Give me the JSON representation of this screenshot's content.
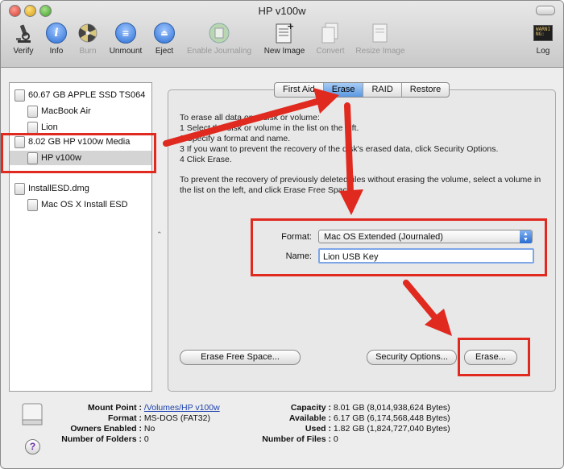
{
  "window": {
    "title": "HP v100w"
  },
  "toolbar": {
    "items": [
      {
        "label": "Verify",
        "icon": "microscope-icon"
      },
      {
        "label": "Info",
        "icon": "info-icon"
      },
      {
        "label": "Burn",
        "icon": "burn-icon"
      },
      {
        "label": "Unmount",
        "icon": "unmount-icon"
      },
      {
        "label": "Eject",
        "icon": "eject-icon"
      },
      {
        "label": "Enable Journaling",
        "icon": "journaling-icon"
      },
      {
        "label": "New Image",
        "icon": "new-image-icon"
      },
      {
        "label": "Convert",
        "icon": "convert-icon"
      },
      {
        "label": "Resize Image",
        "icon": "resize-image-icon"
      },
      {
        "label": "Log",
        "icon": "log-icon"
      }
    ],
    "log_badge": "WARNI\nNG:"
  },
  "sidebar": {
    "items": [
      {
        "label": "60.67 GB APPLE SSD TS064"
      },
      {
        "label": "MacBook Air"
      },
      {
        "label": "Lion"
      },
      {
        "label": "8.02 GB HP v100w Media"
      },
      {
        "label": "HP v100w"
      },
      {
        "label": "InstallESD.dmg"
      },
      {
        "label": "Mac OS X Install ESD"
      }
    ]
  },
  "tabs": [
    "First Aid",
    "Erase",
    "RAID",
    "Restore"
  ],
  "erase": {
    "instructions": [
      "To erase all data on a disk or volume:",
      "1 Select the disk or volume in the list on the left.",
      "2 Specify a format and name.",
      "3 If you want to prevent the recovery of the disk's erased data, click Security Options.",
      "4 Click Erase."
    ],
    "note": "To prevent the recovery of previously deleted files without erasing the volume, select a volume in the list on the left, and click Erase Free Space.",
    "format_label": "Format:",
    "format_value": "Mac OS Extended (Journaled)",
    "name_label": "Name:",
    "name_value": "Lion USB Key",
    "erase_free_space": "Erase Free Space...",
    "security_options": "Security Options...",
    "erase_button": "Erase..."
  },
  "info": {
    "left": [
      {
        "label": "Mount Point :",
        "value": "/Volumes/HP v100w"
      },
      {
        "label": "Format :",
        "value": "MS-DOS (FAT32)"
      },
      {
        "label": "Owners Enabled :",
        "value": "No"
      },
      {
        "label": "Number of Folders :",
        "value": "0"
      }
    ],
    "right": [
      {
        "label": "Capacity :",
        "value": "8.01 GB (8,014,938,624 Bytes)"
      },
      {
        "label": "Available :",
        "value": "6.17 GB (6,174,568,448 Bytes)"
      },
      {
        "label": "Used :",
        "value": "1.82 GB (1,824,727,040 Bytes)"
      },
      {
        "label": "Number of Files :",
        "value": "0"
      }
    ],
    "help": "?"
  },
  "colors": {
    "annotation_red": "#e0291f",
    "selection_blue": "#5a98e2"
  }
}
